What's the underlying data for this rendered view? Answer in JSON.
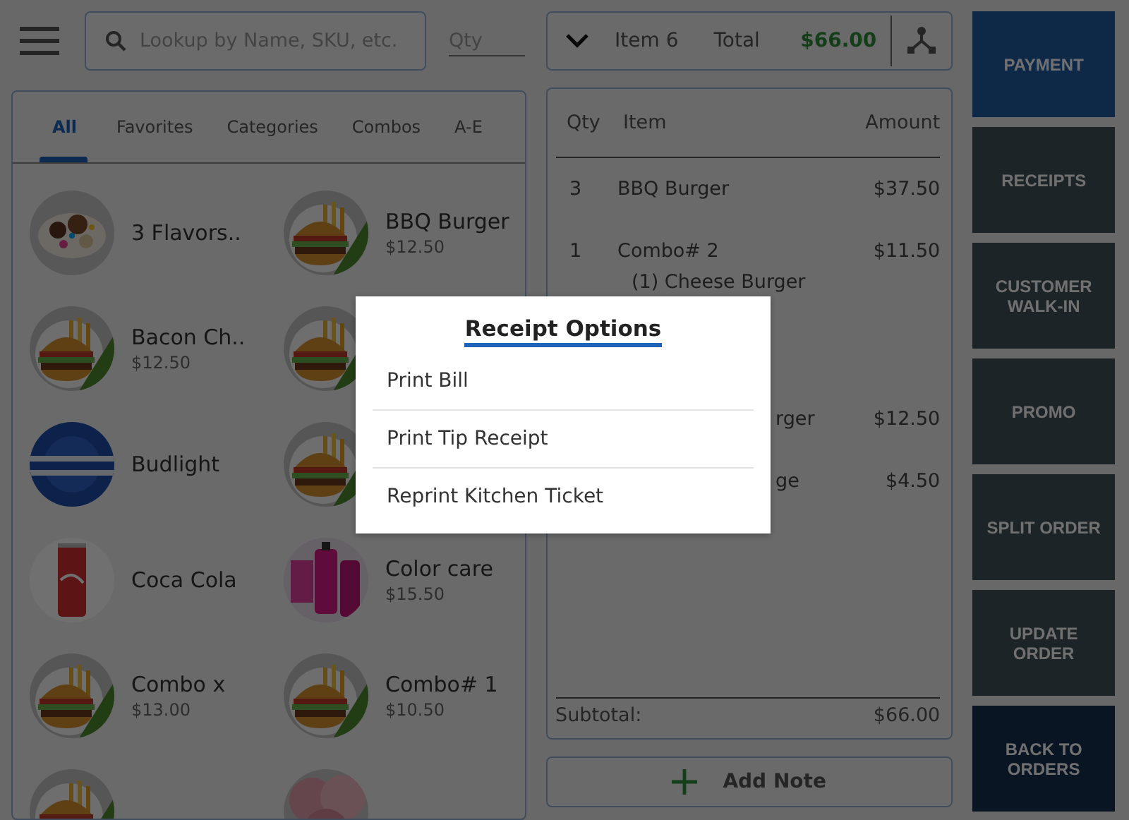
{
  "search": {
    "placeholder": "Lookup by Name, SKU, etc."
  },
  "qty_field": {
    "placeholder": "Qty"
  },
  "tabs": [
    {
      "label": "All",
      "selected": true
    },
    {
      "label": "Favorites",
      "selected": false
    },
    {
      "label": "Categories",
      "selected": false
    },
    {
      "label": "Combos",
      "selected": false
    },
    {
      "label": "A-E",
      "selected": false
    }
  ],
  "product_rows": [
    [
      {
        "kind": "dessert",
        "name": "3 Flavors.."
      },
      {
        "kind": "burger",
        "name": "BBQ Burger",
        "price": "$12.50"
      }
    ],
    [
      {
        "kind": "burger",
        "name": "Bacon Ch..",
        "price": "$12.50"
      },
      {
        "kind": "burger"
      }
    ],
    [
      {
        "kind": "beer",
        "name": "Budlight"
      },
      {
        "kind": "burger"
      }
    ],
    [
      {
        "kind": "can",
        "name": "Coca Cola"
      },
      {
        "kind": "cosmetics",
        "name": "Color care",
        "price": "$15.50"
      }
    ],
    [
      {
        "kind": "burger",
        "name": "Combo x",
        "price": "$13.00"
      },
      {
        "kind": "burger",
        "name": "Combo# 1",
        "price": "$10.50"
      }
    ],
    [
      {
        "kind": "burger"
      },
      {
        "kind": "donut"
      }
    ]
  ],
  "order_header": {
    "items": "Item 6",
    "total_label": "Total",
    "total": "$66.00"
  },
  "order_columns": [
    "Qty",
    "Item",
    "Amount"
  ],
  "order_rows": [
    {
      "qty": "3",
      "item": "BBQ Burger",
      "amount": "$37.50"
    },
    {
      "qty": "1",
      "item": "Combo# 2",
      "amount": "$11.50",
      "modifiers": [
        "(1) Cheese Burger"
      ]
    },
    {
      "item": "rger",
      "amount": "$12.50"
    },
    {
      "item": "ge",
      "amount": "$4.50"
    }
  ],
  "subtotal": {
    "label": "Subtotal:",
    "value": "$66.00"
  },
  "add_note": "Add Note",
  "actions": [
    {
      "label": "PAYMENT",
      "kind": "primary"
    },
    {
      "label": "RECEIPTS",
      "kind": "normal"
    },
    {
      "label": "CUSTOMER WALK-IN",
      "kind": "normal"
    },
    {
      "label": "PROMO",
      "kind": "normal"
    },
    {
      "label": "SPLIT ORDER",
      "kind": "normal"
    },
    {
      "label": "UPDATE ORDER",
      "kind": "normal"
    },
    {
      "label": "BACK TO ORDERS",
      "kind": "back"
    }
  ],
  "dialog": {
    "title": "Receipt Options",
    "options": [
      "Print Bill",
      "Print Tip Receipt",
      "Reprint Kitchen Ticket"
    ]
  }
}
